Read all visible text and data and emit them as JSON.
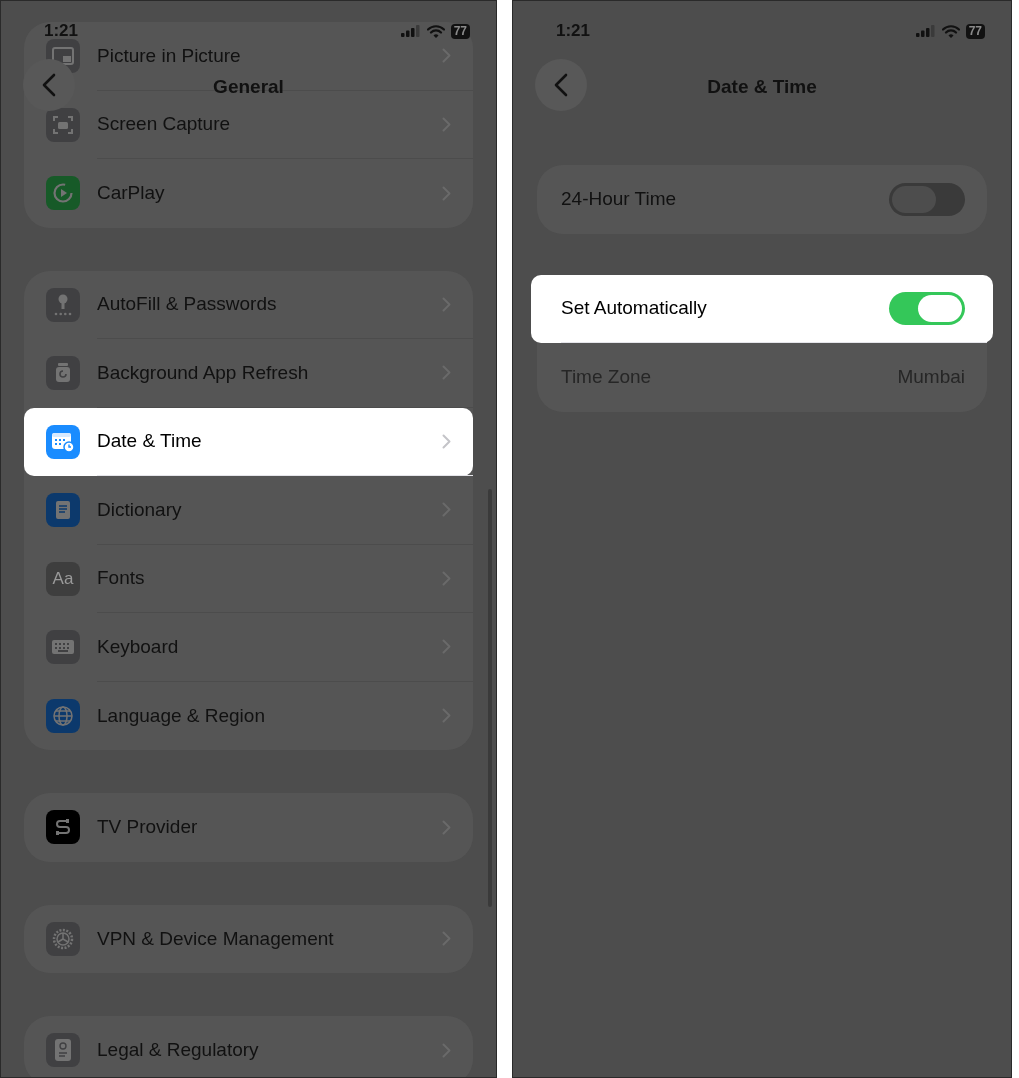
{
  "screens": [
    {
      "status_bar": {
        "time": "1:21",
        "battery": "77"
      },
      "title": "General",
      "scrollbar": true,
      "groups": [
        {
          "rows": [
            {
              "kind": "link",
              "label": "Picture in Picture",
              "highlighted": false
            },
            {
              "kind": "link",
              "label": "Screen Capture",
              "highlighted": false
            },
            {
              "kind": "link",
              "label": "CarPlay",
              "highlighted": false
            }
          ]
        },
        {
          "rows": [
            {
              "kind": "link",
              "label": "AutoFill & Passwords",
              "highlighted": false
            },
            {
              "kind": "link",
              "label": "Background App Refresh",
              "highlighted": false
            },
            {
              "kind": "link",
              "label": "Date & Time",
              "highlighted": true
            },
            {
              "kind": "link",
              "label": "Dictionary",
              "highlighted": false
            },
            {
              "kind": "link",
              "label": "Fonts",
              "icon_text": "Aa",
              "highlighted": false
            },
            {
              "kind": "link",
              "label": "Keyboard",
              "highlighted": false
            },
            {
              "kind": "link",
              "label": "Language & Region",
              "highlighted": false
            }
          ]
        },
        {
          "rows": [
            {
              "kind": "link",
              "label": "TV Provider",
              "highlighted": false
            }
          ]
        },
        {
          "rows": [
            {
              "kind": "link",
              "label": "VPN & Device Management",
              "highlighted": false
            }
          ]
        },
        {
          "rows": [
            {
              "kind": "link",
              "label": "Legal & Regulatory",
              "highlighted": false
            }
          ]
        }
      ]
    },
    {
      "status_bar": {
        "time": "1:21",
        "battery": "77"
      },
      "title": "Date & Time",
      "groups": [
        {
          "rows": [
            {
              "kind": "toggle",
              "label": "24-Hour Time",
              "on": false,
              "highlighted": false
            }
          ]
        },
        {
          "rows": [
            {
              "kind": "toggle",
              "label": "Set Automatically",
              "on": true,
              "highlighted": true
            },
            {
              "kind": "value",
              "label": "Time Zone",
              "value": "Mumbai",
              "disabled": true,
              "highlighted": false
            }
          ]
        }
      ]
    }
  ]
}
